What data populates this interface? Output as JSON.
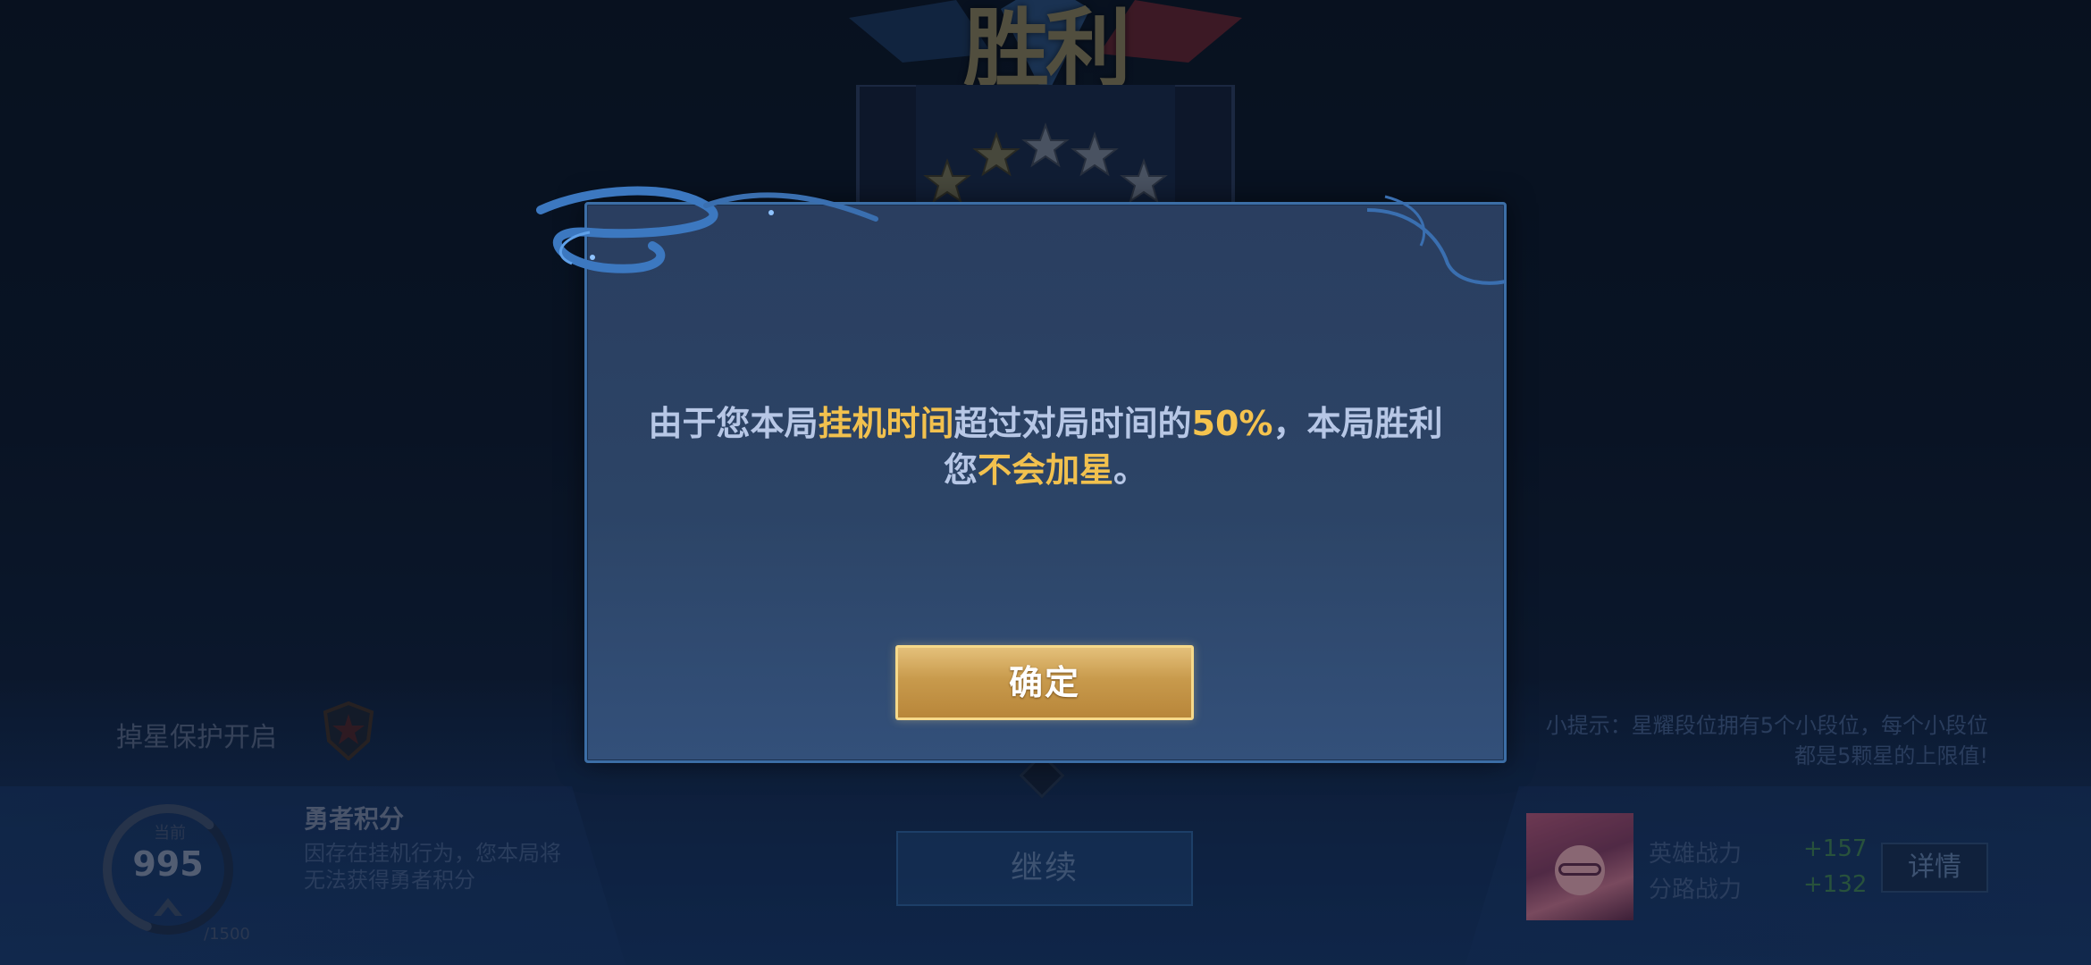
{
  "background": {
    "victory_title": "胜利",
    "protection_label": "掉星保护开启",
    "score": {
      "caption": "当前",
      "value": "995",
      "max": "/1500",
      "progress_fraction": 0.663
    },
    "brave_points": {
      "title": "勇者积分",
      "note": "因存在挂机行为，您本局将无法获得勇者积分"
    },
    "continue_label": "继续",
    "tip": "小提示：星耀段位拥有5个小段位，每个小段位都是5颗星的上限值!",
    "hero_stats": [
      {
        "label": "英雄战力",
        "value": "+157"
      },
      {
        "label": "分路战力",
        "value": "+132"
      }
    ],
    "details_label": "详情"
  },
  "dialog": {
    "line1_parts": [
      "由于您本局",
      "挂机时间",
      "超过对局时间的",
      "50%",
      "，本局胜利"
    ],
    "line2_parts": [
      "您",
      "不会加星",
      "。"
    ],
    "confirm_label": "确定"
  },
  "colors": {
    "highlight": "#f2c14e",
    "dialog_border": "#3c6ea6",
    "confirm_gold": "#c89a4c",
    "stat_positive": "#3c7a52"
  }
}
